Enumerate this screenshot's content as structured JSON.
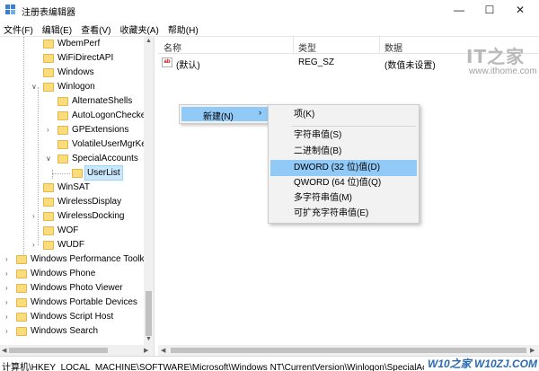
{
  "window": {
    "title": "注册表编辑器",
    "minimize_glyph": "—",
    "maximize_glyph": "☐",
    "close_glyph": "✕"
  },
  "menubar": [
    "文件(F)",
    "编辑(E)",
    "查看(V)",
    "收藏夹(A)",
    "帮助(H)"
  ],
  "tree": {
    "items": [
      {
        "label": "WbemPerf"
      },
      {
        "label": "WiFiDirectAPI"
      },
      {
        "label": "Windows"
      },
      {
        "label": "Winlogon"
      },
      {
        "label": "AlternateShells"
      },
      {
        "label": "AutoLogonChecked"
      },
      {
        "label": "GPExtensions"
      },
      {
        "label": "VolatileUserMgrKey"
      },
      {
        "label": "SpecialAccounts"
      },
      {
        "label": "UserList"
      },
      {
        "label": "WinSAT"
      },
      {
        "label": "WirelessDisplay"
      },
      {
        "label": "WirelessDocking"
      },
      {
        "label": "WOF"
      },
      {
        "label": "WUDF"
      },
      {
        "label": "Windows Performance Toolkit"
      },
      {
        "label": "Windows Phone"
      },
      {
        "label": "Windows Photo Viewer"
      },
      {
        "label": "Windows Portable Devices"
      },
      {
        "label": "Windows Script Host"
      },
      {
        "label": "Windows Search"
      }
    ],
    "expander_collapsed": "›",
    "expander_expanded": "∨"
  },
  "list": {
    "columns": [
      "名称",
      "类型",
      "数据"
    ],
    "rows": [
      {
        "icon": "string-value-icon",
        "icon_text": "ab",
        "name": "(默认)",
        "type": "REG_SZ",
        "data": "(数值未设置)"
      }
    ]
  },
  "watermark": {
    "logo": "IT之家",
    "url": "www.ithome.com",
    "footer": "W10之家 W10ZJ.COM"
  },
  "context_menu": {
    "new_label": "新建(N)",
    "chevron": "›"
  },
  "submenu": {
    "items": [
      {
        "label": "项(K)"
      },
      {
        "label": "字符串值(S)"
      },
      {
        "label": "二进制值(B)"
      },
      {
        "label": "DWORD (32 位)值(D)",
        "highlighted": true
      },
      {
        "label": "QWORD (64 位)值(Q)"
      },
      {
        "label": "多字符串值(M)"
      },
      {
        "label": "可扩充字符串值(E)"
      }
    ]
  },
  "statusbar": {
    "path": "计算机\\HKEY_LOCAL_MACHINE\\SOFTWARE\\Microsoft\\Windows NT\\CurrentVersion\\Winlogon\\SpecialAccounts\\UserList"
  },
  "colors": {
    "highlight": "#91c9f7",
    "selection": "#cce8ff",
    "folder": "#f8dc7d"
  }
}
